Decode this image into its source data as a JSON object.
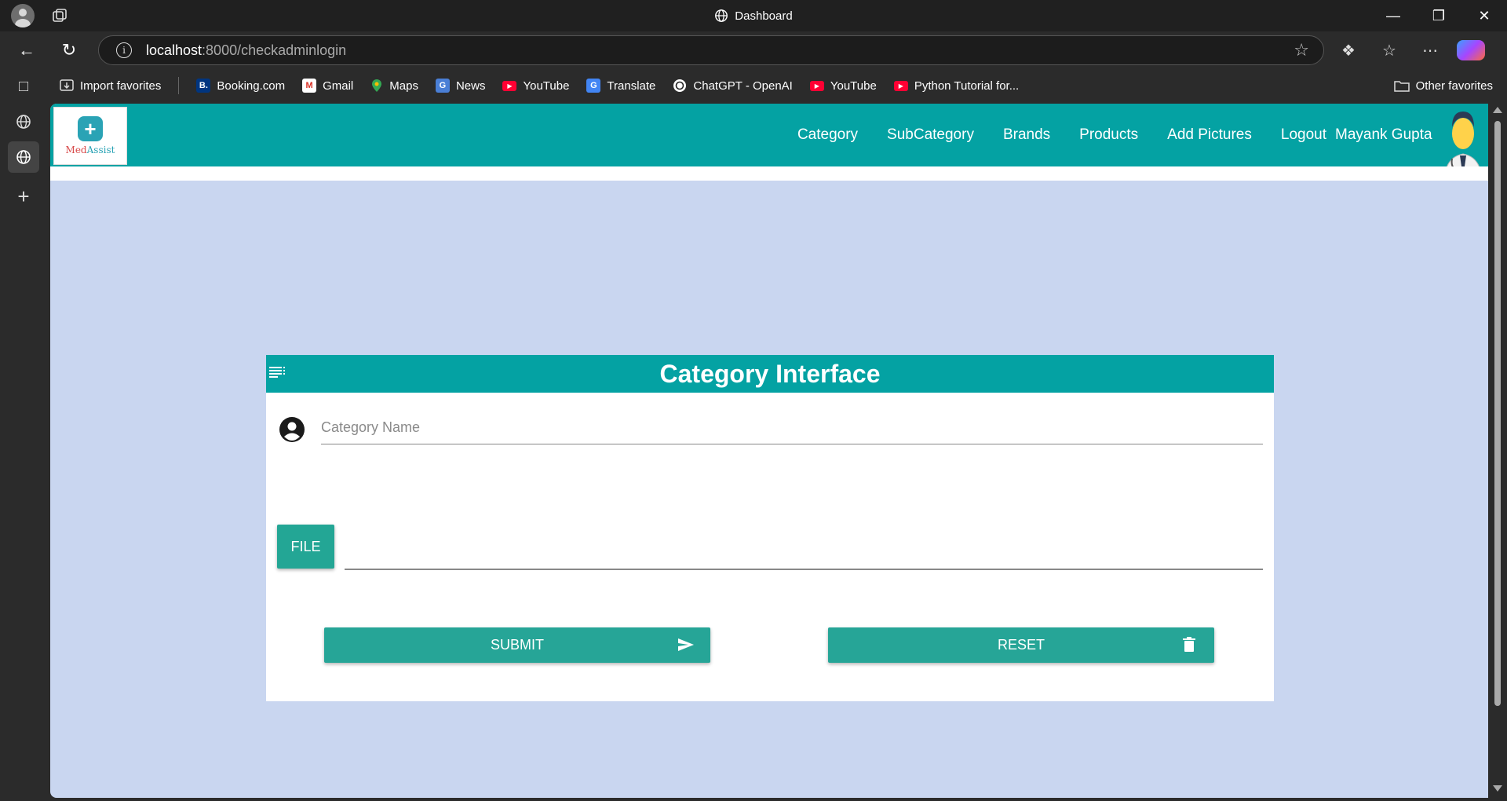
{
  "browser": {
    "tab_title": "Dashboard",
    "url_host": "localhost",
    "url_rest": ":8000/checkadminlogin",
    "window_controls": [
      "minimize-icon",
      "restore-icon",
      "close-icon"
    ]
  },
  "favorites": {
    "items": [
      {
        "label": "Import favorites",
        "icon": "import-icon"
      },
      {
        "label": "Booking.com",
        "icon": "booking-icon",
        "color": "#003580"
      },
      {
        "label": "Gmail",
        "icon": "gmail-icon",
        "color": "#d93025"
      },
      {
        "label": "Maps",
        "icon": "maps-icon",
        "color": "#34a853"
      },
      {
        "label": "News",
        "icon": "news-icon",
        "color": "#4a7fd6"
      },
      {
        "label": "YouTube",
        "icon": "youtube-icon",
        "color": "#ff0033"
      },
      {
        "label": "Translate",
        "icon": "translate-icon",
        "color": "#4285f4"
      },
      {
        "label": "ChatGPT - OpenAI",
        "icon": "chatgpt-icon",
        "color": "#ffffff"
      },
      {
        "label": "YouTube",
        "icon": "youtube-icon",
        "color": "#ff0033"
      },
      {
        "label": "Python Tutorial for...",
        "icon": "youtube-icon",
        "color": "#ff0033"
      }
    ],
    "other": "Other favorites"
  },
  "app": {
    "logo_med": "Med",
    "logo_assist": "Assist",
    "menu": [
      "Category",
      "SubCategory",
      "Brands",
      "Products",
      "Add Pictures",
      "Logout"
    ],
    "user_name": "Mayank Gupta",
    "accent": "#04a2a3",
    "button_color": "#26a597",
    "background": "#c9d6f0"
  },
  "form": {
    "title": "Category Interface",
    "category_placeholder": "Category Name",
    "category_value": "",
    "file_label": "FILE",
    "submit_label": "SUBMIT",
    "reset_label": "RESET"
  }
}
